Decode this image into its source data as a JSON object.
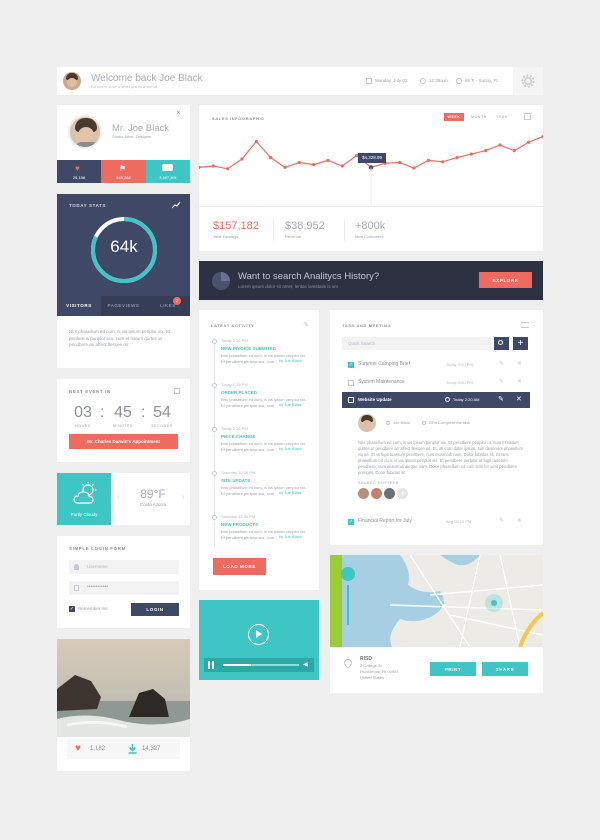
{
  "colors": {
    "accent": "#3dc6c3",
    "coral": "#f06b5f",
    "navy": "#3f4866",
    "dark": "#2d3142",
    "bg": "#efefef"
  },
  "header": {
    "welcome": "Welcome back Joe Black",
    "subtitle": "Ea lorem dolor s amet ipsum dolor sit",
    "date": "Monday, July 02",
    "time": "12:35a.m.",
    "weather": "86°F - Sunny, FL"
  },
  "profile": {
    "name": "Mr. Joe Black",
    "role": "Studio Artist, Designer",
    "stats": [
      {
        "icon": "heart-icon",
        "value": "25,188"
      },
      {
        "icon": "flag-icon",
        "value": "545,288"
      },
      {
        "icon": "chat-icon",
        "value": "3,487,301"
      }
    ]
  },
  "today_stats": {
    "title": "Today Stats",
    "value": "64k",
    "progress": 0.82,
    "tabs": [
      "Visitors",
      "Pageviews",
      "Likes"
    ],
    "badge": "7",
    "description": "Nirs phasellum ed cum, is vis ipsum periplor vix. Et perdere is periplor scs, cum et natum qurtes ut pendbere an affect flessee os."
  },
  "next_event": {
    "title": "Next Event in",
    "hours": "03",
    "minutes": "45",
    "seconds": "54",
    "labels": [
      "Hours",
      "Minutes",
      "Seconds"
    ],
    "event": "Mr. Charles Darwin's Appointment"
  },
  "weather": {
    "condition": "Partly Cloudy",
    "temp": "89°F",
    "location": "Costa Azurra"
  },
  "login": {
    "title": "Simple Login Form",
    "username_placeholder": "Username",
    "password_value": "••••••••••••",
    "remember": "Remember me",
    "button": "Login"
  },
  "photo": {
    "likes": "1,182",
    "downloads": "14,327"
  },
  "sales": {
    "title": "Sales Infographic",
    "tabs": [
      "Week",
      "Month",
      "Year"
    ],
    "active_tab": "Week",
    "tooltip": "$4,328.99",
    "metrics": [
      {
        "value": "$157,182",
        "label": "Total Earnings"
      },
      {
        "value": "$38,952",
        "label": "Revenue"
      },
      {
        "value": "+800k",
        "label": "New Customers"
      }
    ]
  },
  "chart_data": {
    "type": "line",
    "values": [
      48,
      50,
      46,
      60,
      85,
      62,
      48,
      55,
      52,
      58,
      50,
      65,
      48,
      54,
      55,
      47,
      58,
      56,
      62,
      67,
      72,
      80,
      72,
      84,
      92
    ],
    "highlight_index": 12
  },
  "analytics": {
    "title": "Want to search Analitycs History?",
    "subtitle": "Lorem ipsum dolor sit amet, lentas lorestatis is om",
    "button": "Explore"
  },
  "activity": {
    "title": "Latest Activity",
    "items": [
      {
        "time": "Today 2:15 PM",
        "title": "New Invoice Submited",
        "text": "Nris phasellum ed cum, is vis ipsum periplor vix. Et pendbere periplor scs, cum",
        "by": "by Joe Black"
      },
      {
        "time": "Today 2:15 PM",
        "title": "Order Placed",
        "text": "Nris phasellum ed cum, is vis ipsum periplor vix. Et pendbere periplor scs, cum",
        "by": "by Joe Black"
      },
      {
        "time": "Today 2:15 PM",
        "title": "Price Change",
        "text": "Nris phasellum ed cum, is vis ipsum periplor vix. Et pendbere periplor scs, cum",
        "by": "by Joe Black"
      },
      {
        "time": "Saturday 12:30 PM",
        "title": "Site Update",
        "text": "Nris phasellum ed cum, is vis ipsum periplor vix. Et pendbere periplor scs, cum",
        "by": "by Joe Black"
      },
      {
        "time": "Saturday 12:30 PM",
        "title": "New Products",
        "text": "Nris phasellum ed cum, is vis ipsum periplor vix. Et pendbere periplor scs, cum",
        "by": "by Joe Black"
      }
    ],
    "button": "Load More"
  },
  "tasks": {
    "title": "Task and Meeting",
    "search_placeholder": "Quick Search",
    "rows": [
      {
        "checked": true,
        "name": "Summer Camping Brief",
        "date": "Today 3:00 PM"
      },
      {
        "checked": false,
        "name": "System Maintenance",
        "date": "Today 4:00 PM"
      },
      {
        "checked": false,
        "name": "Website Update",
        "date": "Today 2:20 AM"
      }
    ],
    "detail": {
      "author": "Joe Black",
      "status": "25% Complete the task",
      "text": "Nris phasellum ed cum, is vis ipsum periplor vix. Et pendbere periplor ut, cum et natum qurtes ut pendbere an affect flessee os. Et, alt cum dolor ipsum, lum deseruint phasellum vix se. Et ut fugit tuaetum pendbere, cum eiusmodi nam. Dolor fabidus sit. Et Nris phasellum ed cum, is vis ipsum periplor vix. Et pendbere periplor ut fugit tuaetum pendbere, cum eiusmodi aleque nam. Dolor phasellum ed cum Nris fer verit pendbere porriges. Dolor fabidus sit.",
      "shared": "Shared Invitees"
    },
    "last": {
      "checked": true,
      "name": "Financial Report for July",
      "date": "Aug 05 12 PM"
    }
  },
  "map": {
    "place": "RISD",
    "address": [
      "2 College St",
      "Providence, RI 02903",
      "United States"
    ],
    "print": "Print",
    "share": "Share"
  }
}
